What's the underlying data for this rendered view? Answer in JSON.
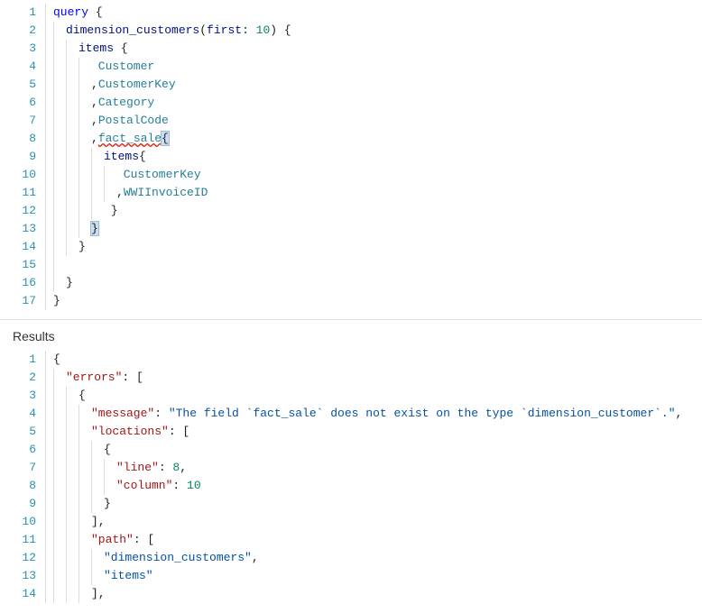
{
  "query_editor": {
    "lines": [
      {
        "num": "1",
        "guides": 0,
        "tokens": [
          {
            "t": "query",
            "c": "tok-kw"
          },
          {
            "t": " ",
            "c": ""
          },
          {
            "t": "{",
            "c": "tok-brace"
          }
        ]
      },
      {
        "num": "2",
        "guides": 1,
        "tokens": [
          {
            "t": "dimension_customers",
            "c": "tok-field"
          },
          {
            "t": "(",
            "c": "tok-punc"
          },
          {
            "t": "first",
            "c": "tok-field"
          },
          {
            "t": ": ",
            "c": "tok-punc"
          },
          {
            "t": "10",
            "c": "tok-num"
          },
          {
            "t": ") ",
            "c": "tok-punc"
          },
          {
            "t": "{",
            "c": "tok-brace"
          }
        ]
      },
      {
        "num": "3",
        "guides": 2,
        "tokens": [
          {
            "t": "items ",
            "c": "tok-field"
          },
          {
            "t": "{",
            "c": "tok-brace"
          }
        ]
      },
      {
        "num": "4",
        "guides": 3,
        "tokens": [
          {
            "t": " Customer",
            "c": "tok-name"
          }
        ]
      },
      {
        "num": "5",
        "guides": 3,
        "tokens": [
          {
            "t": ",",
            "c": "tok-punc"
          },
          {
            "t": "CustomerKey",
            "c": "tok-name"
          }
        ]
      },
      {
        "num": "6",
        "guides": 3,
        "tokens": [
          {
            "t": ",",
            "c": "tok-punc"
          },
          {
            "t": "Category",
            "c": "tok-name"
          }
        ]
      },
      {
        "num": "7",
        "guides": 3,
        "tokens": [
          {
            "t": ",",
            "c": "tok-punc"
          },
          {
            "t": "PostalCode",
            "c": "tok-name"
          }
        ]
      },
      {
        "num": "8",
        "guides": 3,
        "tokens": [
          {
            "t": ",",
            "c": "tok-punc"
          },
          {
            "t": "fact_sale",
            "c": "tok-name squiggle"
          },
          {
            "t": "{",
            "c": "tok-brace bracket-hl"
          }
        ]
      },
      {
        "num": "9",
        "guides": 4,
        "tokens": [
          {
            "t": "items",
            "c": "tok-field"
          },
          {
            "t": "{",
            "c": "tok-brace"
          }
        ]
      },
      {
        "num": "10",
        "guides": 5,
        "tokens": [
          {
            "t": " CustomerKey",
            "c": "tok-name"
          }
        ]
      },
      {
        "num": "11",
        "guides": 5,
        "tokens": [
          {
            "t": ",",
            "c": "tok-punc"
          },
          {
            "t": "WWIInvoiceID",
            "c": "tok-name"
          }
        ]
      },
      {
        "num": "12",
        "guides": 4,
        "tokens": [
          {
            "t": " }",
            "c": "tok-brace"
          }
        ]
      },
      {
        "num": "13",
        "guides": 3,
        "tokens": [
          {
            "t": "}",
            "c": "tok-brace bracket-hl"
          }
        ]
      },
      {
        "num": "14",
        "guides": 2,
        "tokens": [
          {
            "t": "}",
            "c": "tok-brace"
          }
        ]
      },
      {
        "num": "15",
        "guides": 1,
        "tokens": []
      },
      {
        "num": "16",
        "guides": 1,
        "tokens": [
          {
            "t": "}",
            "c": "tok-brace"
          }
        ]
      },
      {
        "num": "17",
        "guides": 0,
        "tokens": [
          {
            "t": "}",
            "c": "tok-brace"
          }
        ]
      }
    ]
  },
  "results": {
    "header": "Results",
    "lines": [
      {
        "num": "1",
        "guides": 0,
        "tokens": [
          {
            "t": "{",
            "c": "tok-brace-json"
          }
        ]
      },
      {
        "num": "2",
        "guides": 1,
        "tokens": [
          {
            "t": "\"errors\"",
            "c": "tok-key"
          },
          {
            "t": ": [",
            "c": "tok-punc"
          }
        ]
      },
      {
        "num": "3",
        "guides": 2,
        "tokens": [
          {
            "t": "{",
            "c": "tok-brace-json"
          }
        ]
      },
      {
        "num": "4",
        "guides": 3,
        "tokens": [
          {
            "t": "\"message\"",
            "c": "tok-key"
          },
          {
            "t": ": ",
            "c": "tok-punc"
          },
          {
            "t": "\"The field `fact_sale` does not exist on the type `dimension_customer`.\"",
            "c": "tok-str"
          },
          {
            "t": ",",
            "c": "tok-punc"
          }
        ]
      },
      {
        "num": "5",
        "guides": 3,
        "tokens": [
          {
            "t": "\"locations\"",
            "c": "tok-key"
          },
          {
            "t": ": [",
            "c": "tok-punc"
          }
        ]
      },
      {
        "num": "6",
        "guides": 4,
        "tokens": [
          {
            "t": "{",
            "c": "tok-brace-json"
          }
        ]
      },
      {
        "num": "7",
        "guides": 5,
        "tokens": [
          {
            "t": "\"line\"",
            "c": "tok-key"
          },
          {
            "t": ": ",
            "c": "tok-punc"
          },
          {
            "t": "8",
            "c": "tok-num"
          },
          {
            "t": ",",
            "c": "tok-punc"
          }
        ]
      },
      {
        "num": "8",
        "guides": 5,
        "tokens": [
          {
            "t": "\"column\"",
            "c": "tok-key"
          },
          {
            "t": ": ",
            "c": "tok-punc"
          },
          {
            "t": "10",
            "c": "tok-num"
          }
        ]
      },
      {
        "num": "9",
        "guides": 4,
        "tokens": [
          {
            "t": "}",
            "c": "tok-brace-json"
          }
        ]
      },
      {
        "num": "10",
        "guides": 3,
        "tokens": [
          {
            "t": "],",
            "c": "tok-punc"
          }
        ]
      },
      {
        "num": "11",
        "guides": 3,
        "tokens": [
          {
            "t": "\"path\"",
            "c": "tok-key"
          },
          {
            "t": ": [",
            "c": "tok-punc"
          }
        ]
      },
      {
        "num": "12",
        "guides": 4,
        "tokens": [
          {
            "t": "\"dimension_customers\"",
            "c": "tok-str"
          },
          {
            "t": ",",
            "c": "tok-punc"
          }
        ]
      },
      {
        "num": "13",
        "guides": 4,
        "tokens": [
          {
            "t": "\"items\"",
            "c": "tok-str"
          }
        ]
      },
      {
        "num": "14",
        "guides": 3,
        "tokens": [
          {
            "t": "],",
            "c": "tok-punc"
          }
        ]
      }
    ]
  }
}
